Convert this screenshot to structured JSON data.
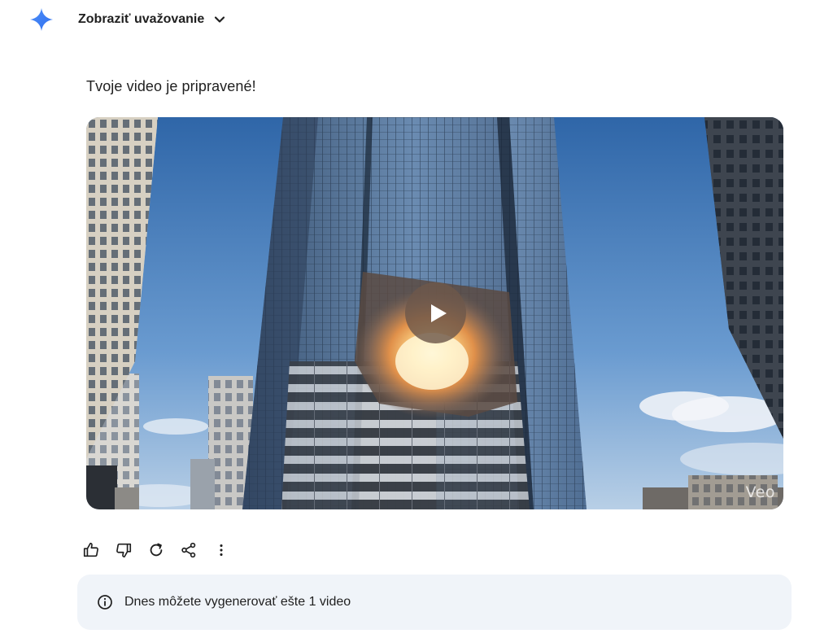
{
  "header": {
    "toggle_label": "Zobraziť uvažovanie",
    "logo_icon": "gemini-spark-icon",
    "chevron_icon": "chevron-down-icon"
  },
  "response": {
    "message": "Tvoje video je pripravené!"
  },
  "video": {
    "watermark": "Veo",
    "play_icon": "play-icon"
  },
  "actions": {
    "items": [
      {
        "icon": "thumbs-up-icon"
      },
      {
        "icon": "thumbs-down-icon"
      },
      {
        "icon": "regenerate-icon"
      },
      {
        "icon": "share-icon"
      },
      {
        "icon": "more-vert-icon"
      }
    ]
  },
  "notice": {
    "icon": "info-icon",
    "text": "Dnes môžete vygenerovať ešte 1 video"
  },
  "colors": {
    "accent": "#4285f4",
    "notice_bg": "#f0f4f9",
    "text": "#1f1f1f"
  }
}
